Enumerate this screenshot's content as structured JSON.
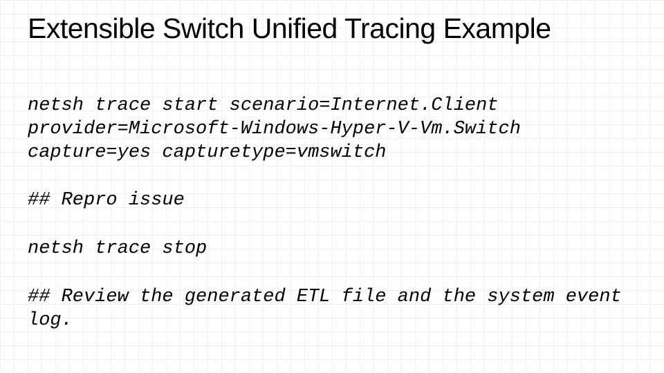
{
  "slide": {
    "title": "Extensible Switch Unified Tracing Example",
    "blocks": {
      "cmd_start": "netsh trace start scenario=Internet.Client provider=Microsoft-Windows-Hyper-V-Vm.Switch capture=yes capturetype=vmswitch",
      "repro": "## Repro issue",
      "cmd_stop": "netsh trace stop",
      "review": "## Review the generated ETL file and the system event log."
    }
  }
}
